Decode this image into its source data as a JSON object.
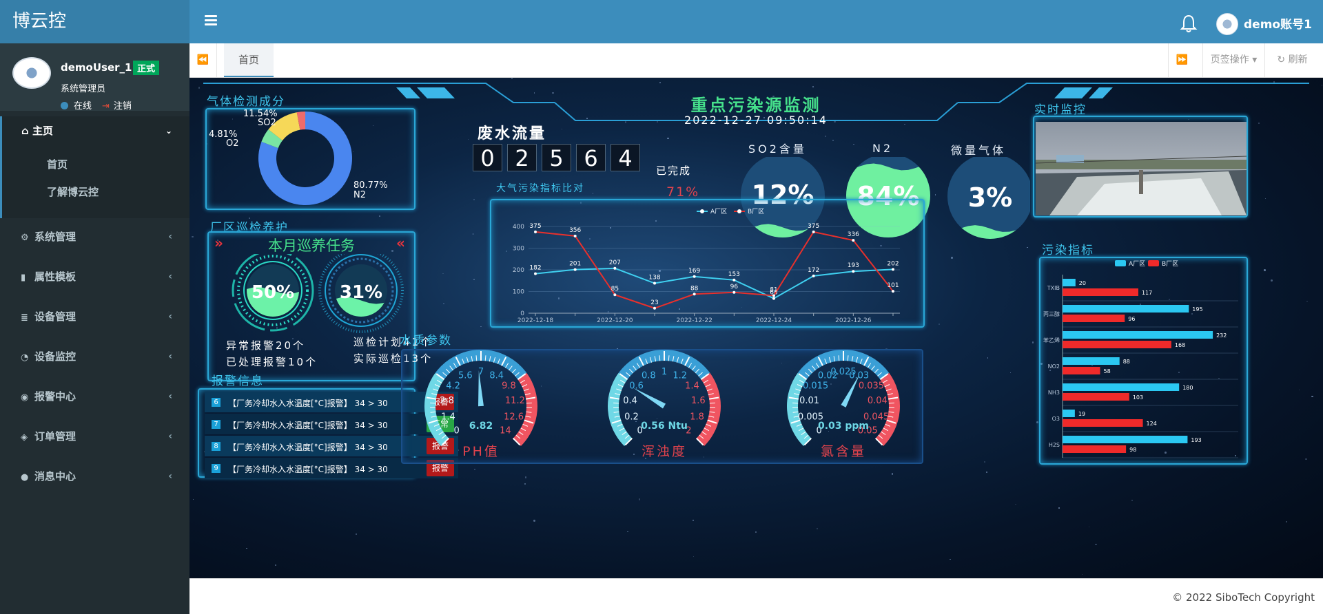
{
  "app": {
    "brand": "博云控",
    "account_name": "demo账号1"
  },
  "user": {
    "name": "demoUser_1",
    "badge": "正式",
    "role": "系统管理员",
    "status": "在线",
    "logout": "注销"
  },
  "sidebar": {
    "home": {
      "label": "主页",
      "children": [
        "首页",
        "了解博云控"
      ]
    },
    "items": [
      {
        "label": "系统管理",
        "icon": "gear-icon"
      },
      {
        "label": "属性模板",
        "icon": "bookmark-icon"
      },
      {
        "label": "设备管理",
        "icon": "database-icon"
      },
      {
        "label": "设备监控",
        "icon": "dashboard-icon"
      },
      {
        "label": "报警中心",
        "icon": "map-marker-icon"
      },
      {
        "label": "订单管理",
        "icon": "cube-icon"
      },
      {
        "label": "消息中心",
        "icon": "comment-icon"
      }
    ]
  },
  "tabs": {
    "active": "首页",
    "tab_ops": "页签操作",
    "refresh": "刷新"
  },
  "dashboard": {
    "title": "重点污染源监测",
    "datetime": "2022-12-27 09:50:14",
    "gas": {
      "section": "气体检测成分",
      "slices": [
        {
          "name": "N2",
          "value": 80.77,
          "label": "80.77%",
          "color": "#4a86ef"
        },
        {
          "name": "O2",
          "value": 4.81,
          "label": "4.81%",
          "color": "#79e4a3"
        },
        {
          "name": "SO2",
          "value": 11.54,
          "label": "11.54%",
          "color": "#f6d858"
        },
        {
          "name": "",
          "value": 2.88,
          "label": "",
          "color": "#ef6b6b"
        }
      ]
    },
    "wastewater": {
      "title": "废水流量",
      "digits": [
        "0",
        "2",
        "5",
        "6",
        "4"
      ],
      "done_label": "已完成",
      "done_value": "71%"
    },
    "bubbles": [
      {
        "label": "SO2含量",
        "value": "12%",
        "fill": 0.12
      },
      {
        "label": "N2",
        "value": "84%",
        "fill": 0.84
      },
      {
        "label": "微量气体",
        "value": "3%",
        "fill": 0.03
      }
    ],
    "inspection": {
      "section": "厂区巡检养护",
      "title": "本月巡养任务",
      "left": {
        "percent": "50%",
        "fill": 0.5,
        "lines": [
          "异常报警20个",
          "已处理报警10个"
        ]
      },
      "right": {
        "percent": "31%",
        "fill": 0.31,
        "lines": [
          "巡检计划41个",
          "实际巡检13个"
        ]
      }
    },
    "alarm": {
      "section": "报警信息",
      "rows": [
        {
          "num": "6",
          "text": "【厂务冷却水入水温度[°C]报警】 34 > 30",
          "tag": "报警",
          "tag_color": "#b3191a"
        },
        {
          "num": "7",
          "text": "【厂务冷却水入水温度[°C]报警】 34 > 30",
          "tag": "正常",
          "tag_color": "#28a745"
        },
        {
          "num": "8",
          "text": "【厂务冷却水入水温度[°C]报警】 34 > 30",
          "tag": "报警",
          "tag_color": "#b3191a"
        },
        {
          "num": "9",
          "text": "【厂务冷却水入水温度[°C]报警】 34 > 30",
          "tag": "报警",
          "tag_color": "#b3191a"
        }
      ]
    },
    "line_section": "大气污染指标比对",
    "water_section": "水质参数",
    "gauges": [
      {
        "label": "PH值",
        "reading": "6.82",
        "value": 6.82,
        "min": 0,
        "max": 14,
        "ticks": [
          "0",
          "1.4",
          "2.8",
          "4.2",
          "5.6",
          "7",
          "8.4",
          "9.8",
          "11.2",
          "12.6",
          "14"
        ]
      },
      {
        "label": "浑浊度",
        "reading": "0.56 Ntu",
        "value": 0.56,
        "min": 0,
        "max": 2,
        "ticks": [
          "0",
          "0.2",
          "0.4",
          "0.6",
          "0.8",
          "1",
          "1.2",
          "1.4",
          "1.6",
          "1.8",
          "2"
        ]
      },
      {
        "label": "氯含量",
        "reading": "0.03 ppm",
        "value": 0.03,
        "min": 0,
        "max": 0.05,
        "ticks": [
          "0",
          "0.005",
          "0.01",
          "0.015",
          "0.02",
          "0.025",
          "0.03",
          "0.035",
          "0.04",
          "0.045",
          "0.05"
        ]
      }
    ],
    "monitor_section": "实时监控",
    "pollution_section": "污染指标",
    "footer": "© 2022 SiboTech Copyright"
  },
  "chart_data": [
    {
      "type": "line",
      "title": "",
      "x": [
        "2022-12-18",
        "2022-12-19",
        "2022-12-20",
        "2022-12-21",
        "2022-12-22",
        "2022-12-23",
        "2022-12-24",
        "2022-12-25",
        "2022-12-26",
        "2022-12-27"
      ],
      "x_tick_labels": [
        "2022-12-18",
        "2022-12-20",
        "2022-12-22",
        "2022-12-24",
        "2022-12-26"
      ],
      "ylim": [
        0,
        400
      ],
      "y_ticks": [
        0,
        100,
        200,
        300,
        400
      ],
      "legend": "top-center",
      "series": [
        {
          "name": "A厂区",
          "color": "#3fd0f0",
          "values": [
            182,
            201,
            207,
            138,
            169,
            153,
            68,
            172,
            193,
            202
          ]
        },
        {
          "name": "B厂区",
          "color": "#e8302c",
          "values": [
            375,
            356,
            85,
            23,
            88,
            96,
            81,
            375,
            336,
            101
          ]
        }
      ]
    },
    {
      "type": "bar",
      "orientation": "horizontal",
      "legend": "top-center",
      "categories": [
        "TXIB",
        "丙三醇",
        "苯乙烯",
        "NO2",
        "NH3",
        "O3",
        "H2S"
      ],
      "xlim": [
        0,
        250
      ],
      "series": [
        {
          "name": "A厂区",
          "color": "#2bc8f2",
          "values": [
            20,
            195,
            232,
            88,
            180,
            19,
            193
          ]
        },
        {
          "name": "B厂区",
          "color": "#ef2a2a",
          "values": [
            117,
            96,
            168,
            58,
            103,
            124,
            98
          ]
        }
      ]
    }
  ]
}
